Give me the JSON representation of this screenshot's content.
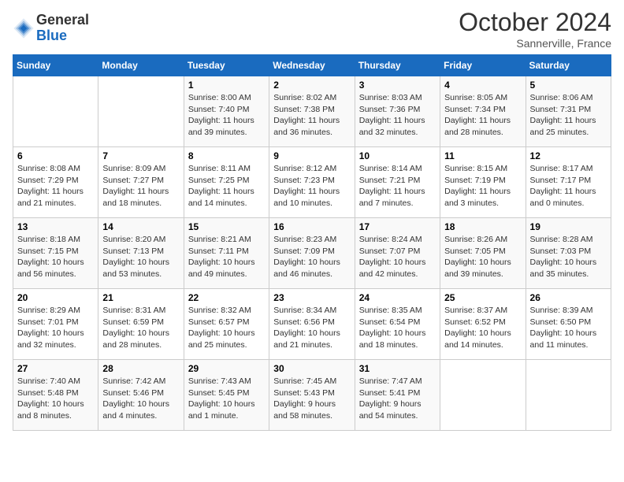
{
  "header": {
    "logo_general": "General",
    "logo_blue": "Blue",
    "month_title": "October 2024",
    "subtitle": "Sannerville, France"
  },
  "weekdays": [
    "Sunday",
    "Monday",
    "Tuesday",
    "Wednesday",
    "Thursday",
    "Friday",
    "Saturday"
  ],
  "weeks": [
    [
      {
        "day": "",
        "sunrise": "",
        "sunset": "",
        "daylight": ""
      },
      {
        "day": "",
        "sunrise": "",
        "sunset": "",
        "daylight": ""
      },
      {
        "day": "1",
        "sunrise": "Sunrise: 8:00 AM",
        "sunset": "Sunset: 7:40 PM",
        "daylight": "Daylight: 11 hours and 39 minutes."
      },
      {
        "day": "2",
        "sunrise": "Sunrise: 8:02 AM",
        "sunset": "Sunset: 7:38 PM",
        "daylight": "Daylight: 11 hours and 36 minutes."
      },
      {
        "day": "3",
        "sunrise": "Sunrise: 8:03 AM",
        "sunset": "Sunset: 7:36 PM",
        "daylight": "Daylight: 11 hours and 32 minutes."
      },
      {
        "day": "4",
        "sunrise": "Sunrise: 8:05 AM",
        "sunset": "Sunset: 7:34 PM",
        "daylight": "Daylight: 11 hours and 28 minutes."
      },
      {
        "day": "5",
        "sunrise": "Sunrise: 8:06 AM",
        "sunset": "Sunset: 7:31 PM",
        "daylight": "Daylight: 11 hours and 25 minutes."
      }
    ],
    [
      {
        "day": "6",
        "sunrise": "Sunrise: 8:08 AM",
        "sunset": "Sunset: 7:29 PM",
        "daylight": "Daylight: 11 hours and 21 minutes."
      },
      {
        "day": "7",
        "sunrise": "Sunrise: 8:09 AM",
        "sunset": "Sunset: 7:27 PM",
        "daylight": "Daylight: 11 hours and 18 minutes."
      },
      {
        "day": "8",
        "sunrise": "Sunrise: 8:11 AM",
        "sunset": "Sunset: 7:25 PM",
        "daylight": "Daylight: 11 hours and 14 minutes."
      },
      {
        "day": "9",
        "sunrise": "Sunrise: 8:12 AM",
        "sunset": "Sunset: 7:23 PM",
        "daylight": "Daylight: 11 hours and 10 minutes."
      },
      {
        "day": "10",
        "sunrise": "Sunrise: 8:14 AM",
        "sunset": "Sunset: 7:21 PM",
        "daylight": "Daylight: 11 hours and 7 minutes."
      },
      {
        "day": "11",
        "sunrise": "Sunrise: 8:15 AM",
        "sunset": "Sunset: 7:19 PM",
        "daylight": "Daylight: 11 hours and 3 minutes."
      },
      {
        "day": "12",
        "sunrise": "Sunrise: 8:17 AM",
        "sunset": "Sunset: 7:17 PM",
        "daylight": "Daylight: 11 hours and 0 minutes."
      }
    ],
    [
      {
        "day": "13",
        "sunrise": "Sunrise: 8:18 AM",
        "sunset": "Sunset: 7:15 PM",
        "daylight": "Daylight: 10 hours and 56 minutes."
      },
      {
        "day": "14",
        "sunrise": "Sunrise: 8:20 AM",
        "sunset": "Sunset: 7:13 PM",
        "daylight": "Daylight: 10 hours and 53 minutes."
      },
      {
        "day": "15",
        "sunrise": "Sunrise: 8:21 AM",
        "sunset": "Sunset: 7:11 PM",
        "daylight": "Daylight: 10 hours and 49 minutes."
      },
      {
        "day": "16",
        "sunrise": "Sunrise: 8:23 AM",
        "sunset": "Sunset: 7:09 PM",
        "daylight": "Daylight: 10 hours and 46 minutes."
      },
      {
        "day": "17",
        "sunrise": "Sunrise: 8:24 AM",
        "sunset": "Sunset: 7:07 PM",
        "daylight": "Daylight: 10 hours and 42 minutes."
      },
      {
        "day": "18",
        "sunrise": "Sunrise: 8:26 AM",
        "sunset": "Sunset: 7:05 PM",
        "daylight": "Daylight: 10 hours and 39 minutes."
      },
      {
        "day": "19",
        "sunrise": "Sunrise: 8:28 AM",
        "sunset": "Sunset: 7:03 PM",
        "daylight": "Daylight: 10 hours and 35 minutes."
      }
    ],
    [
      {
        "day": "20",
        "sunrise": "Sunrise: 8:29 AM",
        "sunset": "Sunset: 7:01 PM",
        "daylight": "Daylight: 10 hours and 32 minutes."
      },
      {
        "day": "21",
        "sunrise": "Sunrise: 8:31 AM",
        "sunset": "Sunset: 6:59 PM",
        "daylight": "Daylight: 10 hours and 28 minutes."
      },
      {
        "day": "22",
        "sunrise": "Sunrise: 8:32 AM",
        "sunset": "Sunset: 6:57 PM",
        "daylight": "Daylight: 10 hours and 25 minutes."
      },
      {
        "day": "23",
        "sunrise": "Sunrise: 8:34 AM",
        "sunset": "Sunset: 6:56 PM",
        "daylight": "Daylight: 10 hours and 21 minutes."
      },
      {
        "day": "24",
        "sunrise": "Sunrise: 8:35 AM",
        "sunset": "Sunset: 6:54 PM",
        "daylight": "Daylight: 10 hours and 18 minutes."
      },
      {
        "day": "25",
        "sunrise": "Sunrise: 8:37 AM",
        "sunset": "Sunset: 6:52 PM",
        "daylight": "Daylight: 10 hours and 14 minutes."
      },
      {
        "day": "26",
        "sunrise": "Sunrise: 8:39 AM",
        "sunset": "Sunset: 6:50 PM",
        "daylight": "Daylight: 10 hours and 11 minutes."
      }
    ],
    [
      {
        "day": "27",
        "sunrise": "Sunrise: 7:40 AM",
        "sunset": "Sunset: 5:48 PM",
        "daylight": "Daylight: 10 hours and 8 minutes."
      },
      {
        "day": "28",
        "sunrise": "Sunrise: 7:42 AM",
        "sunset": "Sunset: 5:46 PM",
        "daylight": "Daylight: 10 hours and 4 minutes."
      },
      {
        "day": "29",
        "sunrise": "Sunrise: 7:43 AM",
        "sunset": "Sunset: 5:45 PM",
        "daylight": "Daylight: 10 hours and 1 minute."
      },
      {
        "day": "30",
        "sunrise": "Sunrise: 7:45 AM",
        "sunset": "Sunset: 5:43 PM",
        "daylight": "Daylight: 9 hours and 58 minutes."
      },
      {
        "day": "31",
        "sunrise": "Sunrise: 7:47 AM",
        "sunset": "Sunset: 5:41 PM",
        "daylight": "Daylight: 9 hours and 54 minutes."
      },
      {
        "day": "",
        "sunrise": "",
        "sunset": "",
        "daylight": ""
      },
      {
        "day": "",
        "sunrise": "",
        "sunset": "",
        "daylight": ""
      }
    ]
  ]
}
